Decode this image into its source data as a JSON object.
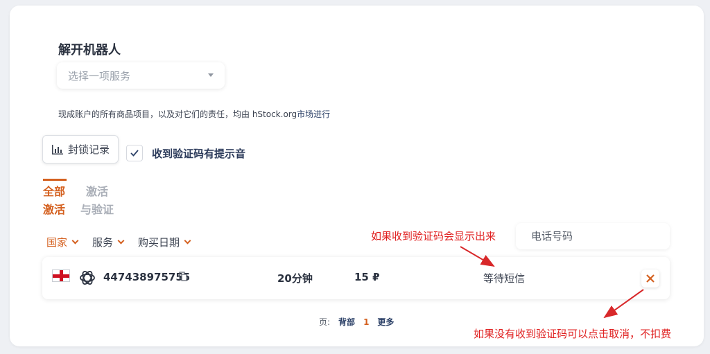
{
  "page": {
    "title": "解开机器人",
    "service_select": {
      "placeholder": "选择一项服务"
    },
    "disclaimer": {
      "text": "现成账户的所有商品项目，以及对它们的责任，均由 hStock.org",
      "link": "市场进行"
    },
    "block_log_button": "封锁记录",
    "sound_option": {
      "label": "收到验证码有提示音",
      "checked": true
    },
    "tabs": [
      {
        "line1": "全部",
        "line2": "激活",
        "active": true
      },
      {
        "line1": "激活",
        "line2": "与验证",
        "active": false
      }
    ],
    "filters": [
      {
        "label": "国家",
        "active": true
      },
      {
        "label": "服务",
        "active": false
      },
      {
        "label": "购买日期",
        "active": false
      }
    ],
    "phone_search": {
      "placeholder": "电话号码"
    },
    "order": {
      "country_flag": "england-flag-icon",
      "service_icon": "openai-icon",
      "phone": "447438975755",
      "duration": "20分钟",
      "price": "15 ₽",
      "status": "等待短信"
    },
    "pagination": {
      "label": "页:",
      "back": "背部",
      "current": "1",
      "more": "更多"
    }
  },
  "annotations": {
    "code_display_note": "如果收到验证码会显示出来",
    "cancel_note": "如果没有收到验证码可以点击取消，不扣费",
    "color": "#e02020"
  },
  "colors": {
    "accent": "#d4601f",
    "link": "#2a3f66",
    "card": "#ffffff",
    "background": "#eef0f4"
  }
}
